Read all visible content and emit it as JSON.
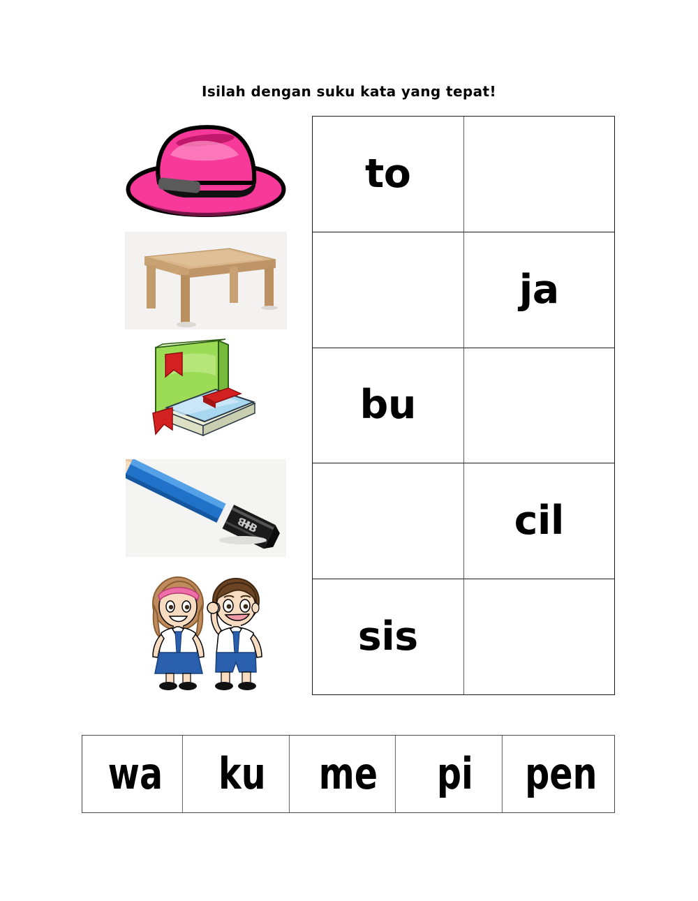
{
  "title": "Isilah dengan suku kata yang tepat!",
  "pictures": [
    {
      "name": "hat",
      "alt": "topi",
      "answer_word": "topi"
    },
    {
      "name": "table",
      "alt": "meja",
      "answer_word": "meja"
    },
    {
      "name": "books",
      "alt": "buku",
      "answer_word": "buku"
    },
    {
      "name": "pencil",
      "alt": "pensil",
      "answer_word": "pencil"
    },
    {
      "name": "students",
      "alt": "siswa",
      "answer_word": "siswa"
    }
  ],
  "syllable_table": {
    "rows": [
      {
        "left": "to",
        "right": ""
      },
      {
        "left": "",
        "right": "ja"
      },
      {
        "left": "bu",
        "right": ""
      },
      {
        "left": "",
        "right": "cil"
      },
      {
        "left": "sis",
        "right": ""
      }
    ]
  },
  "word_bank": {
    "items": [
      "wa",
      "ku",
      "me",
      "pi",
      "pen"
    ]
  },
  "colors": {
    "hat_pink": "#F7399A",
    "hat_pink_dark": "#C2186B",
    "hat_pink_light": "#FF8CC6",
    "wood": "#C9A274",
    "wood_dark": "#A9845A",
    "book_green": "#9BDB56",
    "book_blue": "#A8D8F0",
    "bookmark_red": "#D32020",
    "pencil_blue": "#1F72C8",
    "uniform_blue": "#2A5FAE",
    "skin": "#F2D3B3",
    "hair_girl": "#C08B5C",
    "hair_boy": "#6B4423",
    "border": "#1a1a1a"
  }
}
